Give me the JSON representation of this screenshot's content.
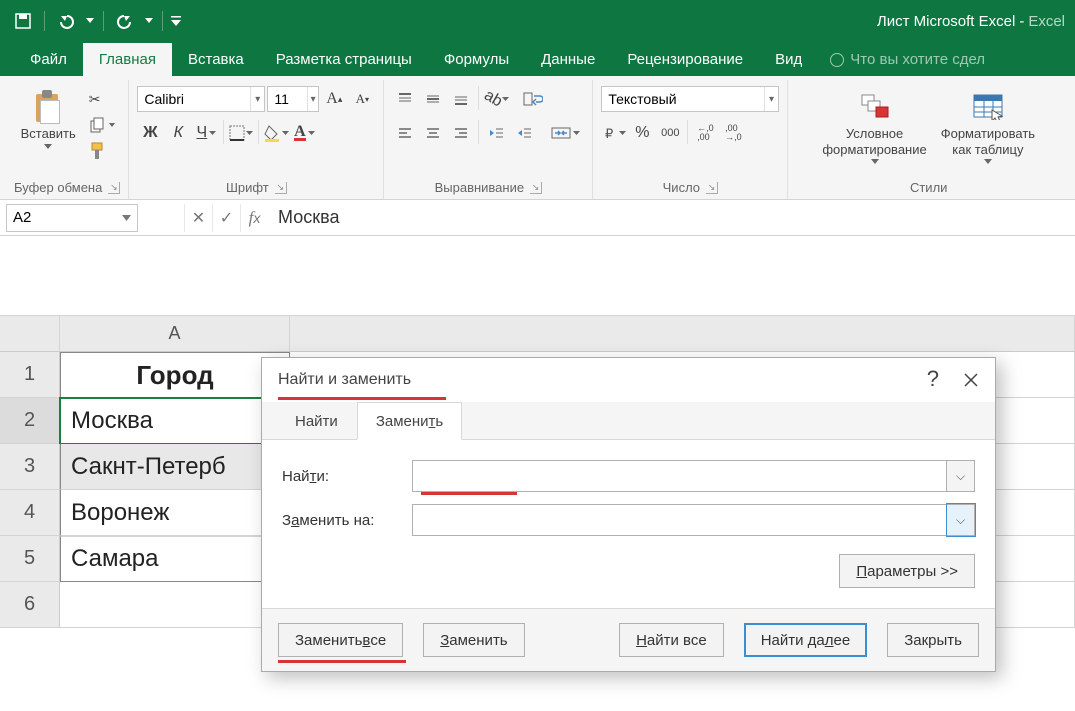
{
  "titlebar": {
    "doc": "Лист Microsoft Excel",
    "app": "Excel"
  },
  "ribbon_tabs": {
    "file": "Файл",
    "home": "Главная",
    "insert": "Вставка",
    "page_layout": "Разметка страницы",
    "formulas": "Формулы",
    "data": "Данные",
    "review": "Рецензирование",
    "view": "Вид",
    "tell_me": "Что вы хотите сдел"
  },
  "ribbon": {
    "clipboard": {
      "paste": "Вставить",
      "group": "Буфер обмена"
    },
    "font": {
      "name": "Calibri",
      "size": "11",
      "bold": "Ж",
      "italic": "К",
      "underline": "Ч",
      "group": "Шрифт"
    },
    "alignment": {
      "group": "Выравнивание"
    },
    "number": {
      "format": "Текстовый",
      "percent": "%",
      "thousands": "000",
      "inc": ",0\n,00",
      "dec": ",00\n,0",
      "group": "Число"
    },
    "styles": {
      "cond": "Условное\nформатирование",
      "table": "Форматировать\nкак таблицу",
      "group": "Стили"
    }
  },
  "namebox": "A2",
  "formula_value": "Москва",
  "columns": {
    "A": "A"
  },
  "rows": [
    "1",
    "2",
    "3",
    "4",
    "5",
    "6"
  ],
  "cells": {
    "A1": "Город",
    "A2": "Москва",
    "A3": "Сакнт-Петерб",
    "A4": "Воронеж",
    "A5": "Самара"
  },
  "dialog": {
    "title": "Найти и заменить",
    "tab_find": "Найти",
    "tab_replace_pre": "Замени",
    "tab_replace_u": "т",
    "tab_replace_post": "ь",
    "find_label_pre": "Най",
    "find_label_u": "т",
    "find_label_post": "и:",
    "replace_label_pre": "З",
    "replace_label_u": "а",
    "replace_label_post": "менить на:",
    "params_u": "П",
    "params_post": "араметры >>",
    "btn_replace_all_pre": "Заменить ",
    "btn_replace_all_u": "в",
    "btn_replace_all_post": "се",
    "btn_replace_u": "З",
    "btn_replace_post": "аменить",
    "btn_find_all_u": "Н",
    "btn_find_all_post": "айти все",
    "btn_find_next_pre": "Найти да",
    "btn_find_next_u": "л",
    "btn_find_next_post": "ее",
    "btn_close": "Закрыть",
    "find_value": "",
    "replace_value": ""
  }
}
